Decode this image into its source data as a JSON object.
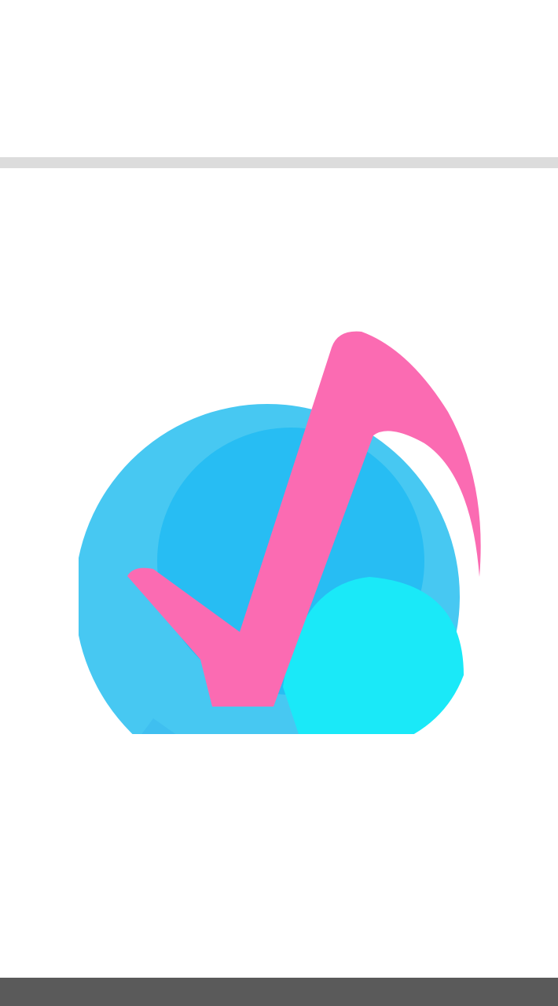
{
  "colors": {
    "background": "#ffffff",
    "divider": "#dcdcdc",
    "bubble_light": "#47c8f2",
    "bubble_mid": "#27bdf3",
    "bubble_cyan": "#1ae9f8",
    "note_pink": "#fb6bb2",
    "bottom_bar": "#5a5a5a"
  },
  "logo": {
    "icon": "chat-bubble-music-note-icon"
  }
}
